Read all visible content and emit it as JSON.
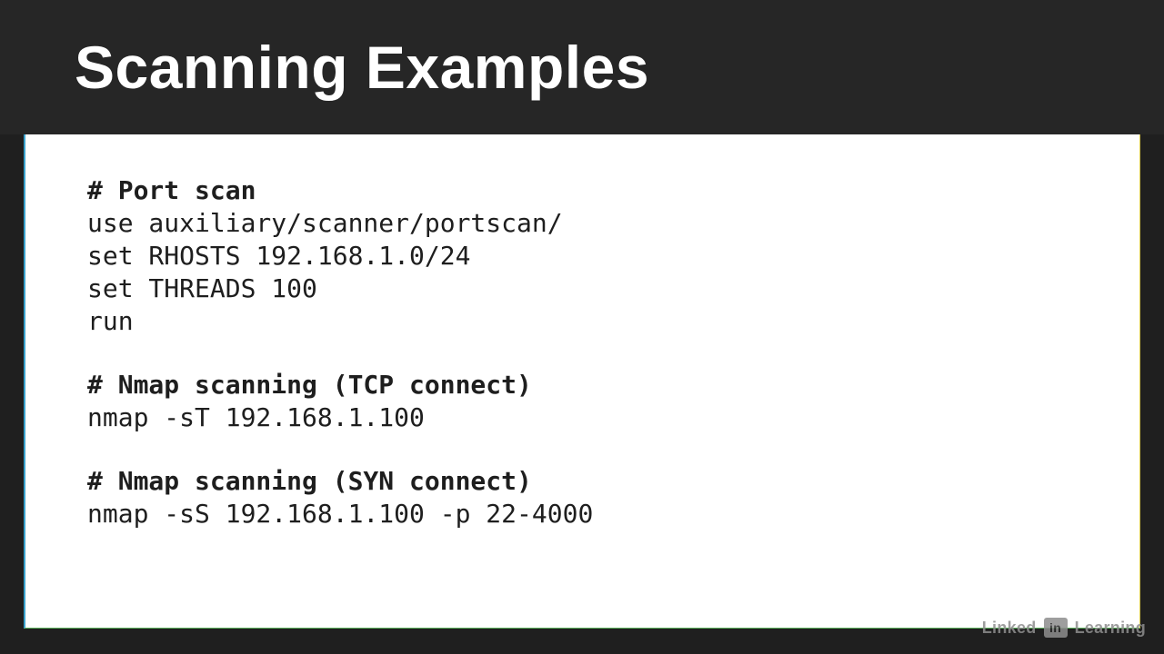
{
  "header": {
    "title": "Scanning Examples"
  },
  "code": {
    "block1": {
      "comment": "# Port scan",
      "l1": "use auxiliary/scanner/portscan/",
      "l2": "set RHOSTS 192.168.1.0/24",
      "l3": "set THREADS 100",
      "l4": "run"
    },
    "block2": {
      "comment": "# Nmap scanning (TCP connect)",
      "l1": "nmap -sT 192.168.1.100"
    },
    "block3": {
      "comment": "# Nmap scanning (SYN connect)",
      "l1": "nmap -sS 192.168.1.100 -p 22-4000"
    }
  },
  "watermark": {
    "brand_left": "Linked",
    "badge": "in",
    "brand_right": "Learning"
  }
}
